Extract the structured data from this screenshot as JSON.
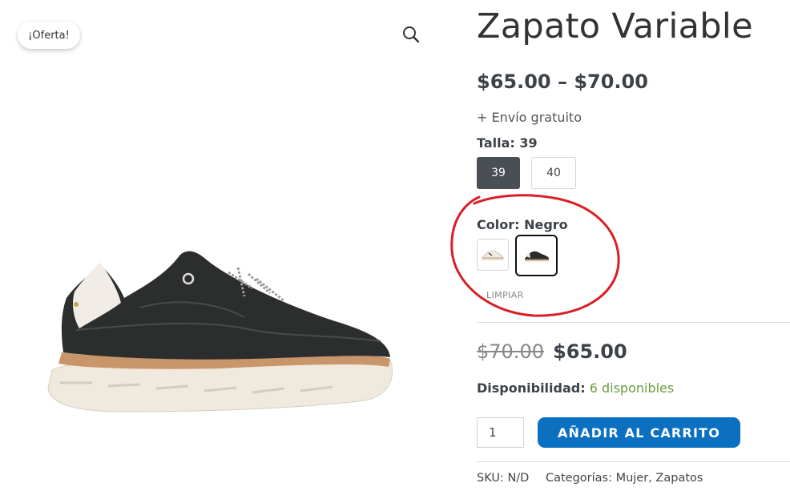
{
  "gallery": {
    "sale_badge": "¡Oferta!",
    "zoom_icon": "search-icon"
  },
  "product": {
    "title": "Zapato Variable",
    "price_range": "$65.00 – $70.00",
    "shipping": "+ Envío gratuito"
  },
  "attributes": {
    "size": {
      "label_prefix": "Talla:",
      "selected": "39",
      "options": [
        "39",
        "40"
      ]
    },
    "color": {
      "label_prefix": "Color:",
      "selected": "Negro",
      "swatches": [
        {
          "name": "cream-shoe-swatch",
          "color": "#efe9df"
        },
        {
          "name": "black-shoe-swatch",
          "color": "#2a2c2b"
        }
      ]
    },
    "clear_label": "LIMPIAR"
  },
  "variant": {
    "old_price": "$70.00",
    "new_price": "$65.00"
  },
  "availability": {
    "label": "Disponibilidad:",
    "value": "6 disponibles"
  },
  "cart": {
    "quantity": "1",
    "button_label": "AÑADIR AL CARRITO"
  },
  "meta": {
    "sku_label": "SKU:",
    "sku_value": "N/D",
    "categories_label": "Categorías:",
    "categories": [
      "Mujer",
      "Zapatos"
    ],
    "separator": ", "
  },
  "colors": {
    "accent_blue": "#0b70c0",
    "availability_green": "#6b9c3f",
    "annotation_red": "#d81f26",
    "selected_swatch": "#4a4f55"
  }
}
